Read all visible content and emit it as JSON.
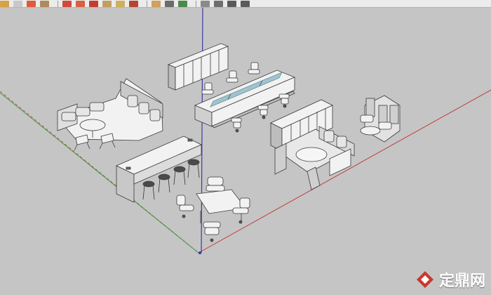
{
  "toolbar": {
    "buttons": [
      {
        "icon": "pencil-icon",
        "color": "#d9a046"
      },
      {
        "icon": "eraser-icon",
        "color": "#c8c8c8"
      },
      {
        "icon": "paint-bucket-icon",
        "color": "#e05a3a"
      },
      {
        "icon": "push-pull-icon",
        "color": "#b08a5a"
      },
      {
        "icon": "move-icon",
        "color": "#d24a3a"
      },
      {
        "icon": "rotate-icon",
        "color": "#d96040"
      },
      {
        "icon": "scale-icon",
        "color": "#c43c30"
      },
      {
        "icon": "offset-icon",
        "color": "#c0a060"
      },
      {
        "icon": "tape-measure-icon",
        "color": "#d0b060"
      },
      {
        "icon": "orbit-icon",
        "color": "#b5452f"
      },
      {
        "icon": "pan-icon",
        "color": "#d2a058"
      },
      {
        "icon": "zoom-icon",
        "color": "#6b6b6b"
      },
      {
        "icon": "zoom-extents-icon",
        "color": "#4b8a4b"
      },
      {
        "icon": "iso-view-icon",
        "color": "#8a8a8a"
      },
      {
        "icon": "top-view-icon",
        "color": "#6e6e6e"
      },
      {
        "icon": "front-view-icon",
        "color": "#5a5a5a"
      },
      {
        "icon": "right-view-icon",
        "color": "#5a5a5a"
      }
    ]
  },
  "colors": {
    "background": "#c5c5c5",
    "axis_red": "#c23b3b",
    "axis_green": "#3c9a3c",
    "axis_blue": "#3a3aa8",
    "furniture": "#f2f2f2",
    "furniture_edge": "#3a3a3a",
    "screen_glass": "#9fc4cf"
  },
  "watermark": {
    "brand": "定鼎网"
  }
}
